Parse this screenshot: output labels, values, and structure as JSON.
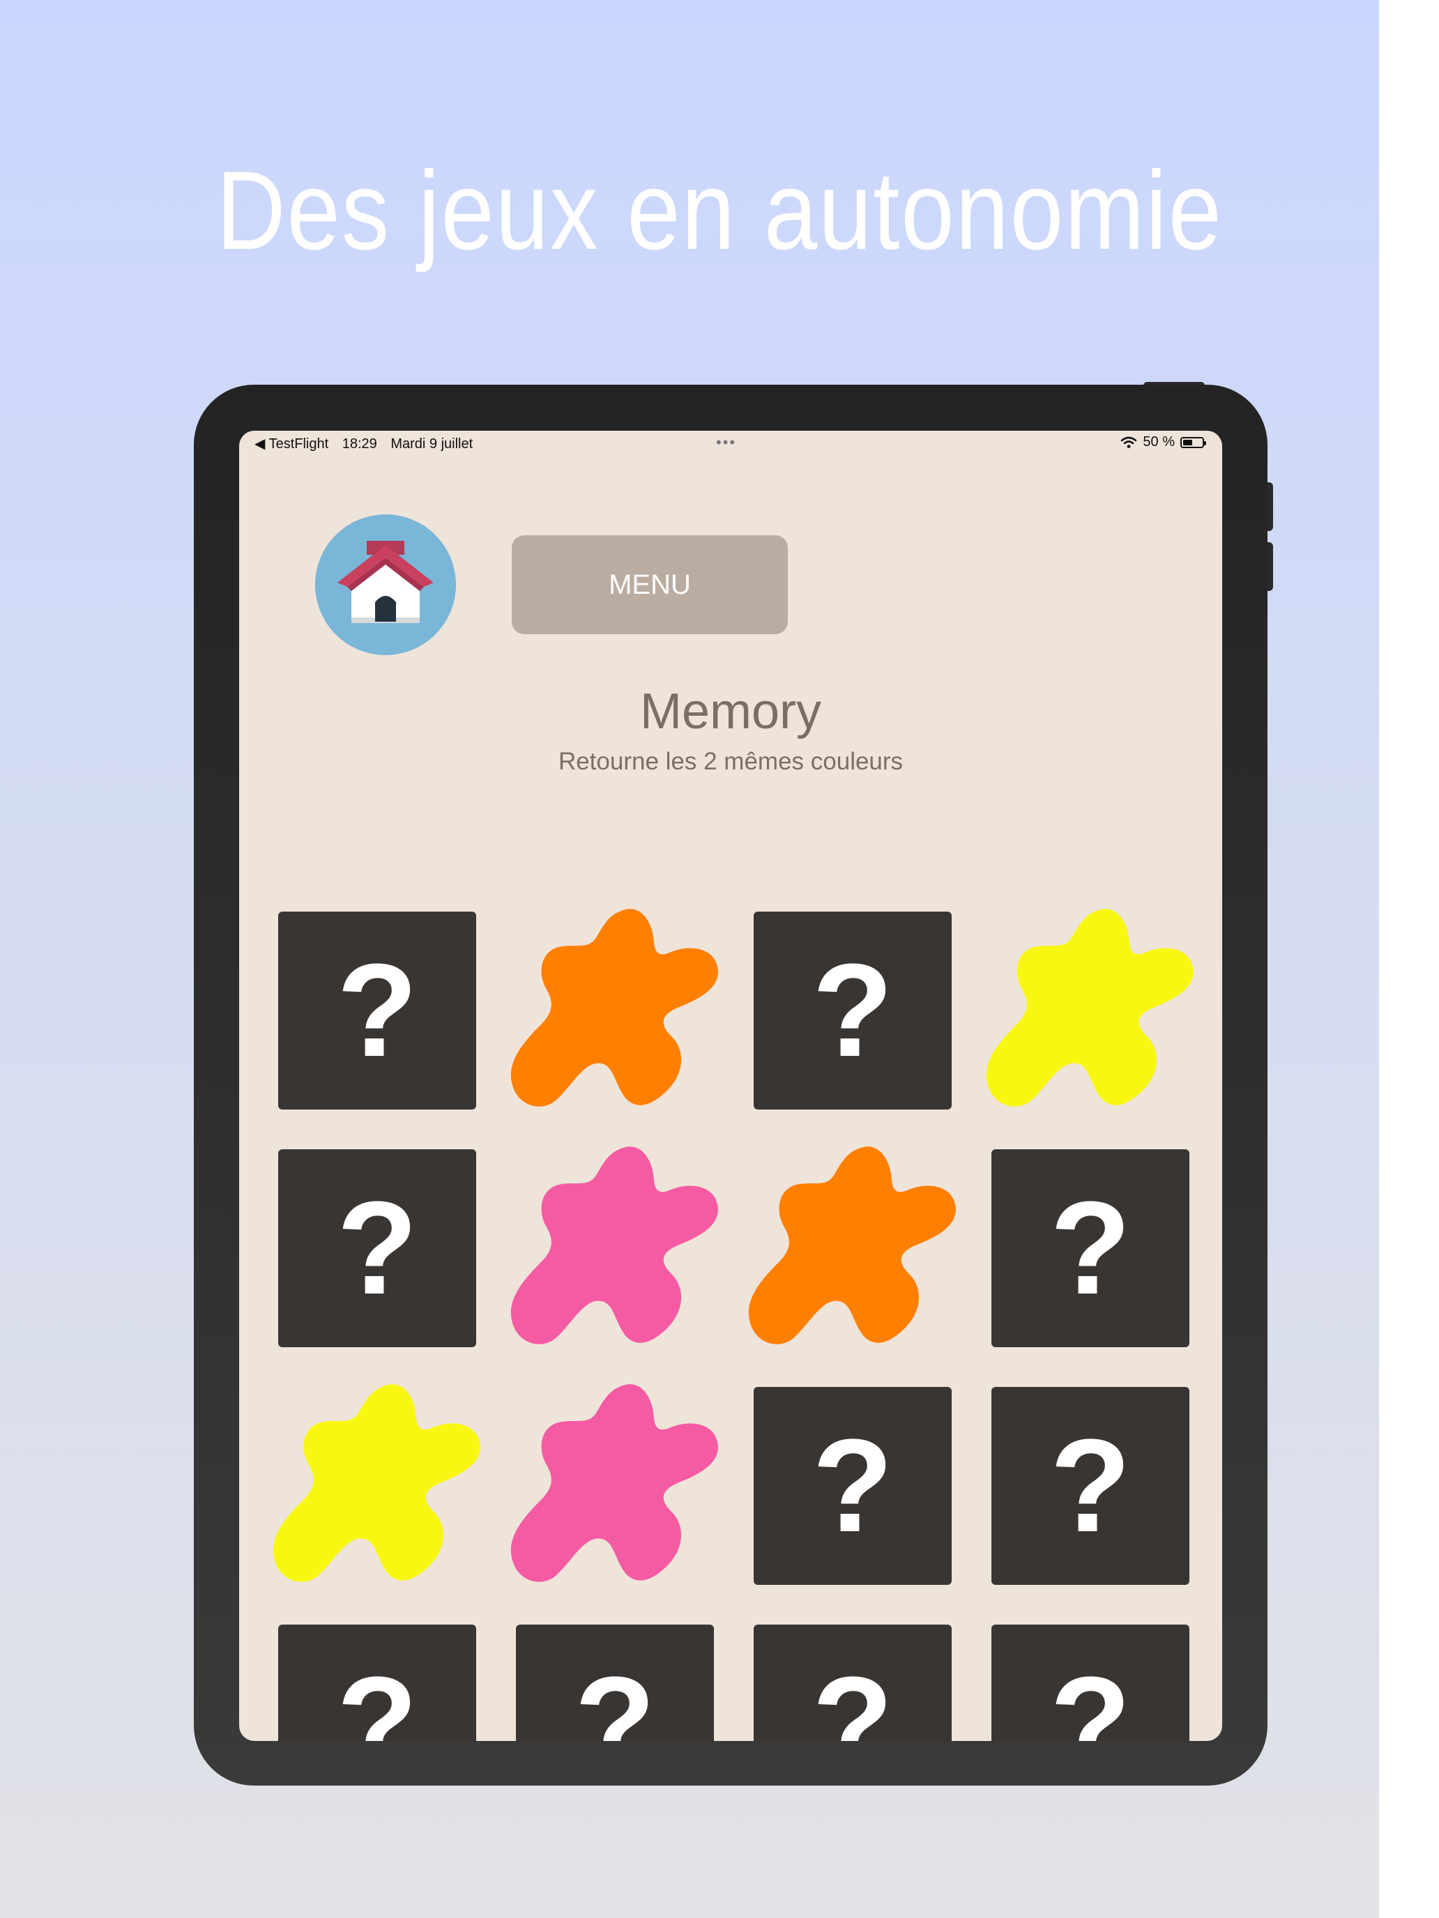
{
  "headline": "Des jeux en autonomie",
  "status_bar": {
    "back_app": "◀ TestFlight",
    "time": "18:29",
    "date": "Mardi 9 juillet",
    "multitask_dots": "•••",
    "battery_text": "50 %",
    "battery_level": 0.5
  },
  "menu_button": {
    "label": "MENU"
  },
  "game": {
    "title": "Memory",
    "subtitle": "Retourne les 2 mêmes couleurs"
  },
  "colors": {
    "orange": "#ff7f00",
    "yellow": "#f8f712",
    "pink": "#f55ba2",
    "card_back": "#393533",
    "screen_bg": "#efe4da",
    "menu_bg": "#baaca0",
    "home_bg": "#7ab6d8"
  },
  "card_back_symbol": "?",
  "cards": [
    {
      "row": 0,
      "col": 0,
      "state": "hidden"
    },
    {
      "row": 0,
      "col": 1,
      "state": "revealed",
      "color": "orange"
    },
    {
      "row": 0,
      "col": 2,
      "state": "hidden"
    },
    {
      "row": 0,
      "col": 3,
      "state": "revealed",
      "color": "yellow"
    },
    {
      "row": 1,
      "col": 0,
      "state": "hidden"
    },
    {
      "row": 1,
      "col": 1,
      "state": "revealed",
      "color": "pink"
    },
    {
      "row": 1,
      "col": 2,
      "state": "revealed",
      "color": "orange"
    },
    {
      "row": 1,
      "col": 3,
      "state": "hidden"
    },
    {
      "row": 2,
      "col": 0,
      "state": "revealed",
      "color": "yellow"
    },
    {
      "row": 2,
      "col": 1,
      "state": "revealed",
      "color": "pink"
    },
    {
      "row": 2,
      "col": 2,
      "state": "hidden"
    },
    {
      "row": 2,
      "col": 3,
      "state": "hidden"
    },
    {
      "row": 3,
      "col": 0,
      "state": "hidden"
    },
    {
      "row": 3,
      "col": 1,
      "state": "hidden"
    },
    {
      "row": 3,
      "col": 2,
      "state": "hidden"
    },
    {
      "row": 3,
      "col": 3,
      "state": "hidden"
    }
  ],
  "icons": {
    "home": "home-icon",
    "wifi": "wifi-icon",
    "battery": "battery-icon",
    "back": "back-arrow-icon"
  }
}
